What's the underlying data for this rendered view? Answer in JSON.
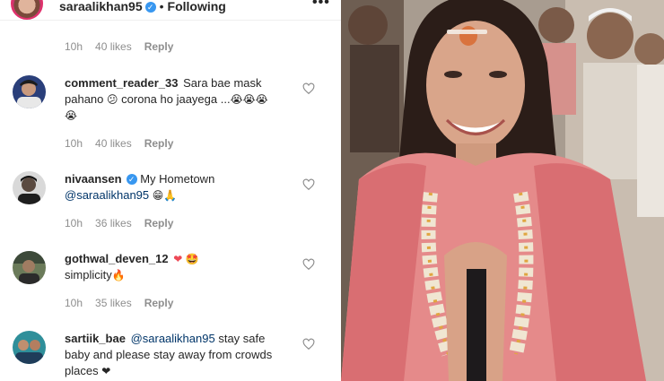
{
  "header": {
    "username": "saraalikhan95",
    "separator": "•",
    "follow_status": "Following",
    "more_label": "•••"
  },
  "first_meta": {
    "time": "10h",
    "likes": "40 likes",
    "reply": "Reply"
  },
  "comments": [
    {
      "username": "comment_reader_33",
      "text_a": "Sara bae mask pahano",
      "emoji_a": "😕",
      "text_b": "corona ho jaayega ...",
      "emoji_b": "😭😭😭😭",
      "time": "10h",
      "likes": "40 likes",
      "reply": "Reply"
    },
    {
      "username": "nivaansen",
      "text_a": "My Hometown",
      "mention": "@saraalikhan95",
      "emoji_a": "😁🙏",
      "time": "10h",
      "likes": "36 likes",
      "reply": "Reply"
    },
    {
      "username": "gothwal_deven_12",
      "emoji_a": "❤",
      "emoji_b": "🤩",
      "text_a": "simplicity",
      "emoji_c": "🔥",
      "time": "10h",
      "likes": "35 likes",
      "reply": "Reply"
    },
    {
      "username": "sartiik_bae",
      "mention": "@saraalikhan95",
      "text_a": "stay safe baby and please stay away from crowds places",
      "emoji_a": "❤"
    }
  ],
  "icons": {
    "verified": "verified-badge-icon",
    "like": "heart-outline-icon"
  },
  "colors": {
    "text": "#262626",
    "meta": "#8e8e8e",
    "verified": "#3897f0",
    "mention": "#003569"
  }
}
